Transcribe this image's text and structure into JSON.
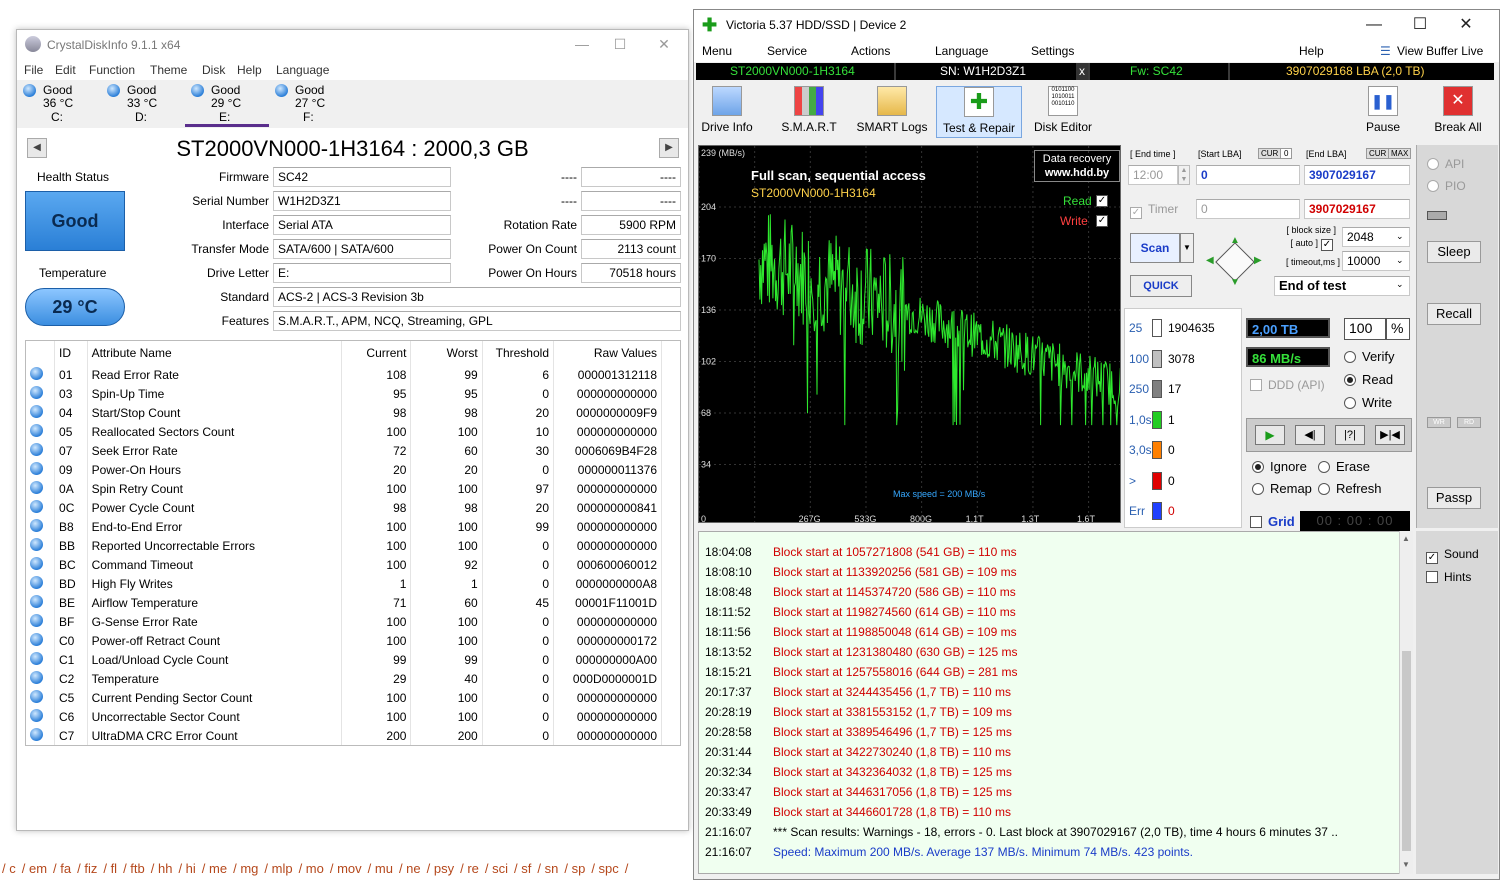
{
  "background": {
    "footer_links": [
      "/ c",
      "/ em",
      "/ fa",
      "/ fiz",
      "/ fl",
      "/ ftb",
      "/ hh",
      "/ hi",
      "/ me",
      "/ mg",
      "/ mlp",
      "/ mo",
      "/ mov",
      "/ mu",
      "/ ne",
      "/ psy",
      "/ re",
      "/ sci",
      "/ sf",
      "/ sn",
      "/ sp",
      "/ spc",
      "/"
    ]
  },
  "cdi": {
    "title": "CrystalDiskInfo 9.1.1 x64",
    "menu": [
      "File",
      "Edit",
      "Function",
      "Theme",
      "Disk",
      "Help",
      "Language"
    ],
    "drives": [
      {
        "status": "Good",
        "temp": "36 °C",
        "letter": "C:"
      },
      {
        "status": "Good",
        "temp": "33 °C",
        "letter": "D:"
      },
      {
        "status": "Good",
        "temp": "29 °C",
        "letter": "E:"
      },
      {
        "status": "Good",
        "temp": "27 °C",
        "letter": "F:"
      }
    ],
    "model": "ST2000VN000-1H3164 : 2000,3 GB",
    "health_label": "Health Status",
    "health_value": "Good",
    "temp_label": "Temperature",
    "temp_value": "29 °C",
    "fields": {
      "firmware_label": "Firmware",
      "firmware": "SC42",
      "serial_label": "Serial Number",
      "serial": "W1H2D3Z1",
      "interface_label": "Interface",
      "interface": "Serial ATA",
      "transfer_label": "Transfer Mode",
      "transfer": "SATA/600 | SATA/600",
      "letter_label": "Drive Letter",
      "letter": "E:",
      "standard_label": "Standard",
      "standard": "ACS-2 | ACS-3 Revision 3b",
      "features_label": "Features",
      "features": "S.M.A.R.T., APM, NCQ, Streaming, GPL",
      "blank_label_1": "----",
      "blank_value_1": "----",
      "blank_label_2": "----",
      "blank_value_2": "----",
      "rotation_label": "Rotation Rate",
      "rotation": "5900 RPM",
      "poc_label": "Power On Count",
      "poc": "2113 count",
      "poh_label": "Power On Hours",
      "poh": "70518 hours"
    },
    "smart_headers": [
      "ID",
      "Attribute Name",
      "Current",
      "Worst",
      "Threshold",
      "Raw Values"
    ],
    "smart_rows": [
      [
        "01",
        "Read Error Rate",
        "108",
        "99",
        "6",
        "000001312118"
      ],
      [
        "03",
        "Spin-Up Time",
        "95",
        "95",
        "0",
        "000000000000"
      ],
      [
        "04",
        "Start/Stop Count",
        "98",
        "98",
        "20",
        "0000000009F9"
      ],
      [
        "05",
        "Reallocated Sectors Count",
        "100",
        "100",
        "10",
        "000000000000"
      ],
      [
        "07",
        "Seek Error Rate",
        "72",
        "60",
        "30",
        "0006069B4F28"
      ],
      [
        "09",
        "Power-On Hours",
        "20",
        "20",
        "0",
        "000000011376"
      ],
      [
        "0A",
        "Spin Retry Count",
        "100",
        "100",
        "97",
        "000000000000"
      ],
      [
        "0C",
        "Power Cycle Count",
        "98",
        "98",
        "20",
        "000000000841"
      ],
      [
        "B8",
        "End-to-End Error",
        "100",
        "100",
        "99",
        "000000000000"
      ],
      [
        "BB",
        "Reported Uncorrectable Errors",
        "100",
        "100",
        "0",
        "000000000000"
      ],
      [
        "BC",
        "Command Timeout",
        "100",
        "92",
        "0",
        "000600060012"
      ],
      [
        "BD",
        "High Fly Writes",
        "1",
        "1",
        "0",
        "0000000000A8"
      ],
      [
        "BE",
        "Airflow Temperature",
        "71",
        "60",
        "45",
        "00001F11001D"
      ],
      [
        "BF",
        "G-Sense Error Rate",
        "100",
        "100",
        "0",
        "000000000000"
      ],
      [
        "C0",
        "Power-off Retract Count",
        "100",
        "100",
        "0",
        "000000000172"
      ],
      [
        "C1",
        "Load/Unload Cycle Count",
        "99",
        "99",
        "0",
        "000000000A00"
      ],
      [
        "C2",
        "Temperature",
        "29",
        "40",
        "0",
        "000D0000001D"
      ],
      [
        "C5",
        "Current Pending Sector Count",
        "100",
        "100",
        "0",
        "000000000000"
      ],
      [
        "C6",
        "Uncorrectable Sector Count",
        "100",
        "100",
        "0",
        "000000000000"
      ],
      [
        "C7",
        "UltraDMA CRC Error Count",
        "200",
        "200",
        "0",
        "000000000000"
      ]
    ]
  },
  "victoria": {
    "title": "Victoria 5.37 HDD/SSD | Device 2",
    "menu": [
      "Menu",
      "Service",
      "Actions",
      "Language",
      "Settings",
      "Help"
    ],
    "view_buffer": "View Buffer Live",
    "info_bar": {
      "model": "ST2000VN000-1H3164",
      "sn": "SN: W1H2D3Z1",
      "x": "x",
      "fw": "Fw: SC42",
      "lba": "3907029168 LBA (2,0 TB)"
    },
    "toolbar": [
      "Drive Info",
      "S.M.A.R.T",
      "SMART Logs",
      "Test & Repair",
      "Disk Editor",
      "Pause",
      "Break All"
    ],
    "graph": {
      "ymax_label": "239 (MB/s)",
      "title1": "Full scan, sequential access",
      "title2": "ST2000VN000-1H3164",
      "recovery1": "Data recovery",
      "recovery2": "www.hdd.by",
      "read_label": "Read",
      "write_label": "Write",
      "max_speed": "Max speed = 200 MB/s",
      "y_ticks": [
        "204",
        "170",
        "136",
        "102",
        "68",
        "34"
      ],
      "x_ticks": [
        "0",
        "267G",
        "533G",
        "800G",
        "1,1T",
        "1,3T",
        "1,6T",
        "1,9T"
      ]
    },
    "scan": {
      "end_time_label": "[ End time ]",
      "end_time": "12:00",
      "start_lba_label": "[Start LBA]",
      "cur": "CUR",
      "zero": "0",
      "start_lba": "0",
      "end_lba_label": "[End LBA]",
      "cur2": "CUR",
      "max": "MAX",
      "end_lba": "3907029167",
      "timer_label": "Timer",
      "timer_value": "0",
      "end_lba2": "3907029167",
      "scan_btn": "Scan",
      "quick_btn": "QUICK",
      "block_size_label": "[ block size ]",
      "auto_label": "[ auto ]",
      "block_size": "2048",
      "timeout_label": "[ timeout,ms ]",
      "timeout": "10000",
      "end_of_test": "End of test"
    },
    "stats": [
      {
        "label": "25",
        "count": "1904635",
        "color": "#ffffff"
      },
      {
        "label": "100",
        "count": "3078",
        "color": "#c0c0c0"
      },
      {
        "label": "250",
        "count": "17",
        "color": "#808080"
      },
      {
        "label": "1,0s",
        "count": "1",
        "color": "#22cc22"
      },
      {
        "label": "3,0s",
        "count": "0",
        "color": "#ff8000"
      },
      {
        "label": ">",
        "count": "0",
        "color": "#e00000"
      },
      {
        "label": "Err",
        "count": "0",
        "color": "#2040ff"
      }
    ],
    "progress": {
      "size": "2,00 TB",
      "percent": "100",
      "pct_sign": "%",
      "speed": "86 MB/s"
    },
    "ddd_label": "DDD (API)",
    "modes": [
      "Verify",
      "Read",
      "Write"
    ],
    "actions": [
      "Ignore",
      "Erase",
      "Remap",
      "Refresh"
    ],
    "grid_label": "Grid",
    "grid_time": "00 : 00 : 00",
    "side": {
      "api": "API",
      "pio": "PIO",
      "sleep": "Sleep",
      "recall": "Recall",
      "wr": "WR",
      "rd": "RD",
      "passp": "Passp",
      "sound": "Sound",
      "hints": "Hints"
    },
    "log": [
      {
        "time": "18:04:08",
        "msg": "Block start at 1057271808 (541 GB)  = 110 ms",
        "color": "#d00000"
      },
      {
        "time": "18:08:10",
        "msg": "Block start at 1133920256 (581 GB)  = 109 ms",
        "color": "#d00000"
      },
      {
        "time": "18:08:48",
        "msg": "Block start at 1145374720 (586 GB)  = 110 ms",
        "color": "#d00000"
      },
      {
        "time": "18:11:52",
        "msg": "Block start at 1198274560 (614 GB)  = 110 ms",
        "color": "#d00000"
      },
      {
        "time": "18:11:56",
        "msg": "Block start at 1198850048 (614 GB)  = 109 ms",
        "color": "#d00000"
      },
      {
        "time": "18:13:52",
        "msg": "Block start at 1231380480 (630 GB)  = 125 ms",
        "color": "#d00000"
      },
      {
        "time": "18:15:21",
        "msg": "Block start at 1257558016 (644 GB)  = 281 ms",
        "color": "#d00000"
      },
      {
        "time": "20:17:37",
        "msg": "Block start at 3244435456 (1,7 TB)  = 110 ms",
        "color": "#d00000"
      },
      {
        "time": "20:28:19",
        "msg": "Block start at 3381553152 (1,7 TB)  = 109 ms",
        "color": "#d00000"
      },
      {
        "time": "20:28:58",
        "msg": "Block start at 3389546496 (1,7 TB)  = 125 ms",
        "color": "#d00000"
      },
      {
        "time": "20:31:44",
        "msg": "Block start at 3422730240 (1,8 TB)  = 110 ms",
        "color": "#d00000"
      },
      {
        "time": "20:32:34",
        "msg": "Block start at 3432364032 (1,8 TB)  = 125 ms",
        "color": "#d00000"
      },
      {
        "time": "20:33:47",
        "msg": "Block start at 3446317056 (1,8 TB)  = 125 ms",
        "color": "#d00000"
      },
      {
        "time": "20:33:49",
        "msg": "Block start at 3446601728 (1,8 TB)  = 110 ms",
        "color": "#d00000"
      },
      {
        "time": "21:16:07",
        "msg": "*** Scan results: Warnings - 18, errors - 0. Last block at 3907029167 (2,0 TB), time 4 hours 6 minutes 37 ..",
        "color": "#000000"
      },
      {
        "time": "21:16:07",
        "msg": "Speed: Maximum 200 MB/s. Average 137 MB/s. Minimum 74 MB/s. 423 points.",
        "color": "#1a3cc8"
      }
    ]
  }
}
